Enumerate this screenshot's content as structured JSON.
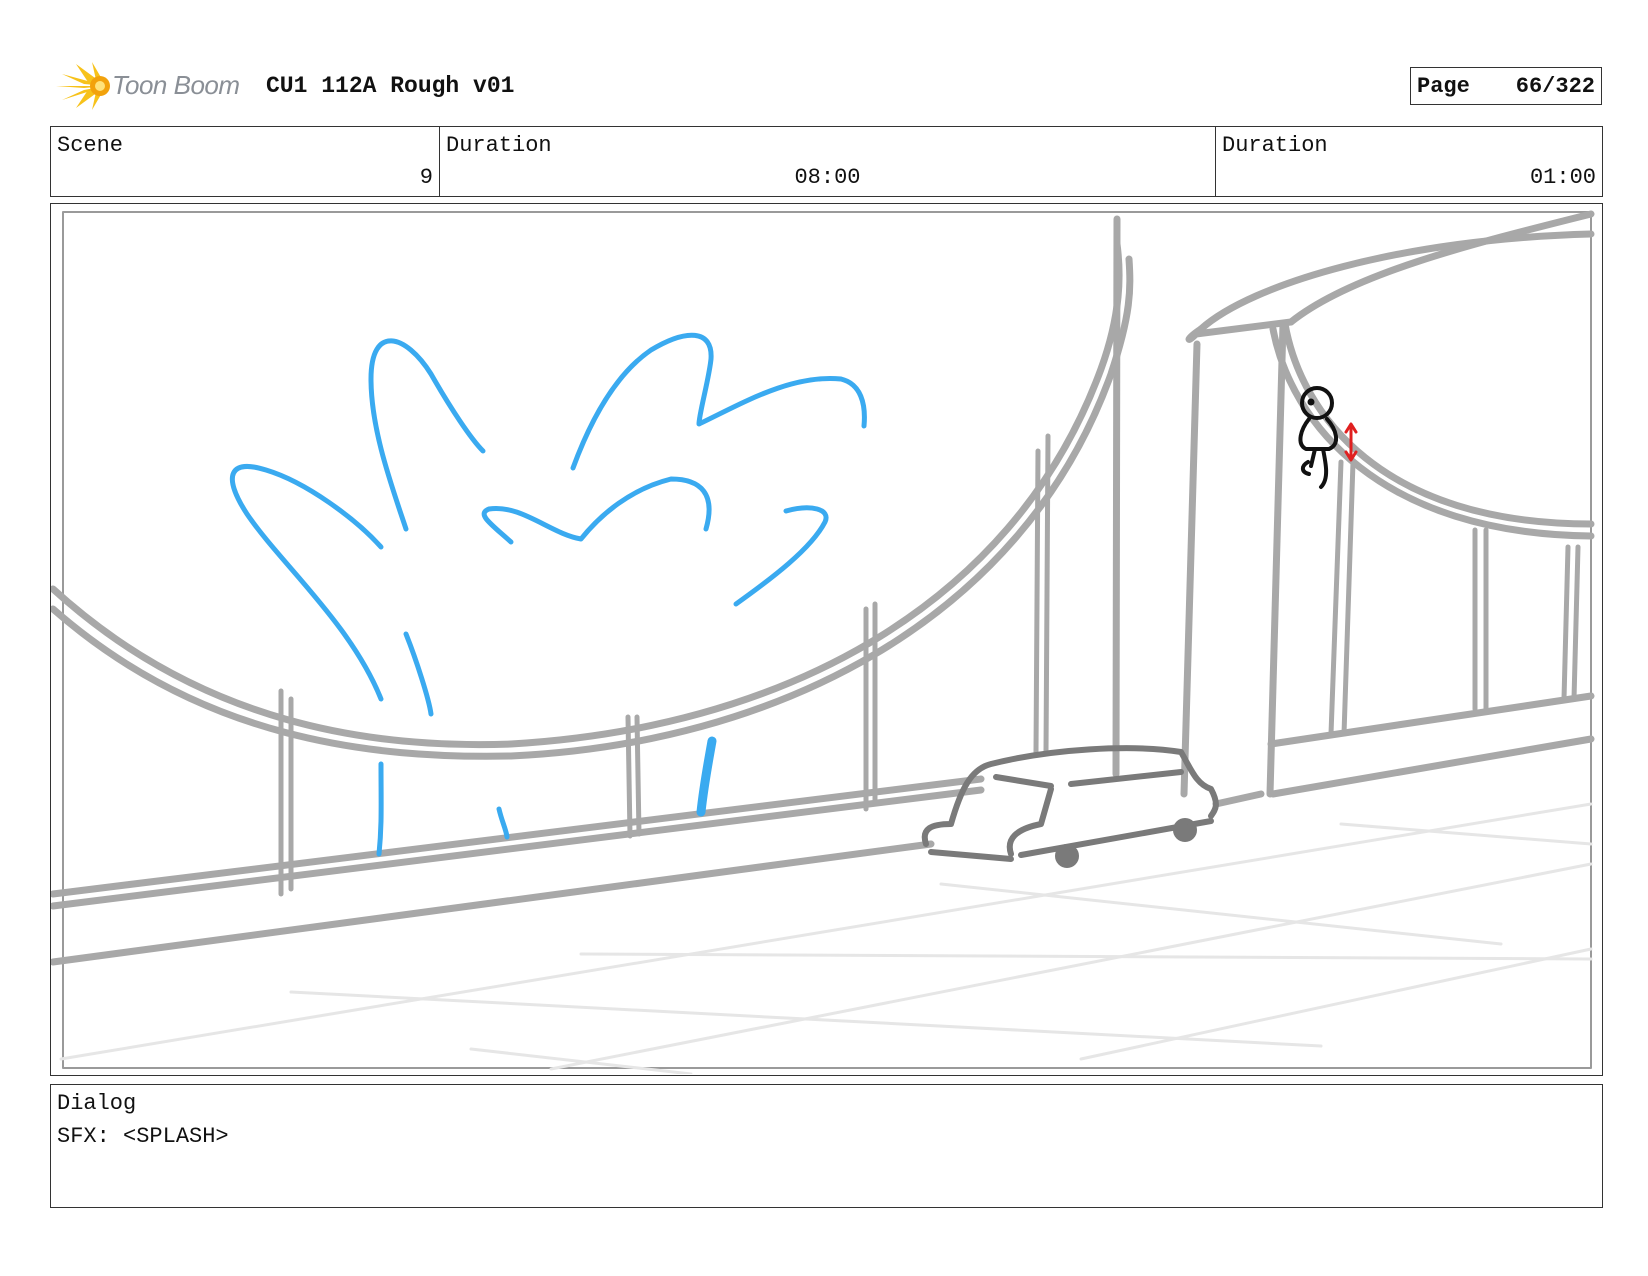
{
  "header": {
    "logo_text": "Toon Boom",
    "project_title": "CU1 112A Rough v01",
    "page_label": "Page",
    "page_value": "66/322"
  },
  "info": {
    "scene_label": "Scene",
    "scene_value": "9",
    "duration_label": "Duration",
    "duration_value": "08:00",
    "panel_duration_label": "Duration",
    "panel_duration_value": "01:00"
  },
  "panel": {
    "drawing": "rough storyboard sketch",
    "colors": {
      "layout": "#a8a8a8",
      "floor": "#e4e4e4",
      "splash": "#3aaaf0",
      "character": "#111111",
      "arrow": "#e02020",
      "car": "#7a7a7a"
    },
    "icon": "red-up-down-arrow-icon"
  },
  "dialog": {
    "label": "Dialog",
    "text": "SFX: <SPLASH>"
  }
}
